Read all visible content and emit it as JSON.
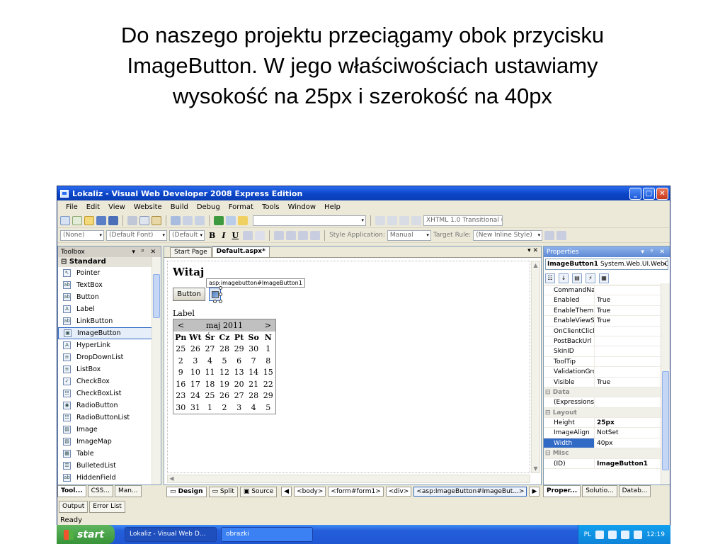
{
  "slide": {
    "title_lines": [
      "Do naszego projektu przeciągamy obok przycisku",
      "ImageButton. W jego właściwościach ustawiamy",
      "wysokość na 25px i szerokość na 40px"
    ]
  },
  "window": {
    "title": "Lokaliz - Visual Web Developer 2008 Express Edition",
    "controls": {
      "minimize": "_",
      "maximize": "□",
      "close": "✕"
    }
  },
  "menu": [
    "File",
    "Edit",
    "View",
    "Website",
    "Build",
    "Debug",
    "Format",
    "Tools",
    "Window",
    "Help"
  ],
  "toolbar2": {
    "block_format": "(None)",
    "font": "(Default Font)",
    "size": "(Default",
    "bold": "B",
    "italic": "I",
    "underline": "U",
    "style_app_label": "Style Application:",
    "style_app_value": "Manual",
    "target_rule_label": "Target Rule:",
    "target_rule_value": "(New Inline Style)"
  },
  "toolbar1": {
    "doctype": "XHTML 1.0 Transitional ("
  },
  "toolbox": {
    "header": "Toolbox",
    "controls": "▾ ᵖ ✕",
    "group": "Standard",
    "items": [
      {
        "label": "Pointer",
        "icon": "↖"
      },
      {
        "label": "TextBox",
        "icon": "ab"
      },
      {
        "label": "Button",
        "icon": "ab"
      },
      {
        "label": "Label",
        "icon": "A"
      },
      {
        "label": "LinkButton",
        "icon": "ab"
      },
      {
        "label": "ImageButton",
        "icon": "▣"
      },
      {
        "label": "HyperLink",
        "icon": "A"
      },
      {
        "label": "DropDownList",
        "icon": "≡"
      },
      {
        "label": "ListBox",
        "icon": "≡"
      },
      {
        "label": "CheckBox",
        "icon": "✓"
      },
      {
        "label": "CheckBoxList",
        "icon": "☷"
      },
      {
        "label": "RadioButton",
        "icon": "◉"
      },
      {
        "label": "RadioButtonList",
        "icon": "☷"
      },
      {
        "label": "Image",
        "icon": "▨"
      },
      {
        "label": "ImageMap",
        "icon": "▨"
      },
      {
        "label": "Table",
        "icon": "▦"
      },
      {
        "label": "BulletedList",
        "icon": "☰"
      },
      {
        "label": "HiddenField",
        "icon": "ab"
      }
    ],
    "bottom_tabs": [
      "Tool...",
      "CSS...",
      "Man..."
    ]
  },
  "editor": {
    "tabs": [
      "Start Page",
      "Default.aspx*"
    ],
    "controls": "▾ ✕",
    "design": {
      "heading": "Witaj",
      "tag_tip": "asp:imagebutton#ImageButton1",
      "button_label": "Button",
      "label_text": "Label",
      "calendar": {
        "prev": "<",
        "month": "maj 2011",
        "next": ">",
        "days": [
          "Pn",
          "Wt",
          "Śr",
          "Cz",
          "Pt",
          "So",
          "N"
        ],
        "weeks": [
          [
            "25",
            "26",
            "27",
            "28",
            "29",
            "30",
            "1"
          ],
          [
            "2",
            "3",
            "4",
            "5",
            "6",
            "7",
            "8"
          ],
          [
            "9",
            "10",
            "11",
            "12",
            "13",
            "14",
            "15"
          ],
          [
            "16",
            "17",
            "18",
            "19",
            "20",
            "21",
            "22"
          ],
          [
            "23",
            "24",
            "25",
            "26",
            "27",
            "28",
            "29"
          ],
          [
            "30",
            "31",
            "1",
            "2",
            "3",
            "4",
            "5"
          ]
        ]
      }
    },
    "view_tabs": [
      "Design",
      "Split",
      "Source"
    ],
    "breadcrumbs": [
      "<body>",
      "<form#form1>",
      "<div>",
      "<asp:ImageButton#ImageBut...>"
    ]
  },
  "properties": {
    "header": "Properties",
    "controls": "▾ ᵖ ✕",
    "object_name": "ImageButton1",
    "object_type": "System.Web.UI.WebC",
    "rows": [
      {
        "key": "CommandName",
        "value": ""
      },
      {
        "key": "Enabled",
        "value": "True"
      },
      {
        "key": "EnableTheming",
        "value": "True"
      },
      {
        "key": "EnableViewState",
        "value": "True"
      },
      {
        "key": "OnClientClick",
        "value": ""
      },
      {
        "key": "PostBackUrl",
        "value": ""
      },
      {
        "key": "SkinID",
        "value": ""
      },
      {
        "key": "ToolTip",
        "value": ""
      },
      {
        "key": "ValidationGroup",
        "value": ""
      },
      {
        "key": "Visible",
        "value": "True"
      }
    ],
    "cat_data": "Data",
    "expressions": "(Expressions)",
    "cat_layout": "Layout",
    "height_key": "Height",
    "height_val": "25px",
    "imagealign_key": "ImageAlign",
    "imagealign_val": "NotSet",
    "width_key": "Width",
    "width_val": "40px",
    "cat_misc": "Misc",
    "id_key": "(ID)",
    "id_val": "ImageButton1",
    "bottom_tabs": [
      "Proper...",
      "Solutio...",
      "Datab..."
    ]
  },
  "output_tabs": [
    "Output",
    "Error List"
  ],
  "status": "Ready",
  "taskbar": {
    "start": "start",
    "tasks": [
      "Lokaliz - Visual Web D...",
      "obrazki"
    ],
    "lang": "PL",
    "clock": "12:19"
  },
  "colors": {
    "title_blue": "#0b44c6",
    "taskbar_blue": "#245edb",
    "start_green": "#379337",
    "selection": "#316ac5"
  }
}
